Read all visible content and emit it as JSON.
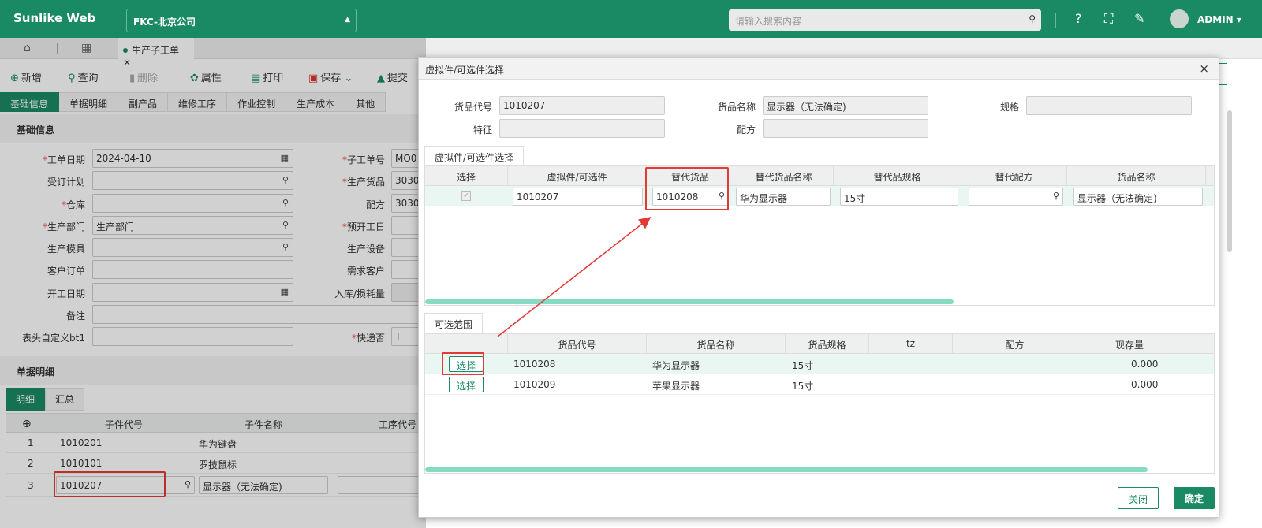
{
  "app": {
    "brand": "Sunlike Web",
    "company": "FKC-北京公司",
    "search_placeholder": "请输入搜索内容",
    "user": "ADMIN"
  },
  "tabs": {
    "doc_tab": "生产子工单"
  },
  "toolbar": {
    "new": "新增",
    "query": "查询",
    "delete": "删除",
    "props": "属性",
    "print": "打印",
    "save": "保存",
    "submit": "提交"
  },
  "form_tabs": [
    "基础信息",
    "单据明细",
    "副产品",
    "维修工序",
    "作业控制",
    "生产成本",
    "其他"
  ],
  "sections": {
    "basic": "基础信息",
    "detail": "单据明细"
  },
  "form": {
    "left": [
      {
        "label": "工单日期",
        "req": true,
        "value": "2024-04-10",
        "icon": "calendar"
      },
      {
        "label": "受订计划",
        "req": false,
        "value": "",
        "icon": "search"
      },
      {
        "label": "仓库",
        "req": true,
        "value": "",
        "icon": "search"
      },
      {
        "label": "生产部门",
        "req": true,
        "value": "生产部门",
        "icon": "search"
      },
      {
        "label": "生产模具",
        "req": false,
        "value": "",
        "icon": "search"
      },
      {
        "label": "客户订单",
        "req": false,
        "value": "",
        "icon": ""
      },
      {
        "label": "开工日期",
        "req": false,
        "value": "",
        "icon": "calendar"
      },
      {
        "label": "备注",
        "req": false,
        "value": "",
        "icon": ""
      },
      {
        "label": "表头自定义bt1",
        "req": false,
        "value": "",
        "icon": ""
      }
    ],
    "right": [
      {
        "label": "子工单号",
        "req": true,
        "value": "MO0"
      },
      {
        "label": "生产货品",
        "req": true,
        "value": "3030"
      },
      {
        "label": "配方",
        "req": false,
        "value": "3030"
      },
      {
        "label": "预开工日",
        "req": true,
        "value": ""
      },
      {
        "label": "生产设备",
        "req": false,
        "value": ""
      },
      {
        "label": "需求客户",
        "req": false,
        "value": ""
      },
      {
        "label": "入库/损耗量",
        "req": false,
        "value": ""
      },
      {
        "label": "",
        "req": false,
        "value": ""
      },
      {
        "label": "快递否",
        "req": true,
        "value": "T"
      }
    ]
  },
  "subtabs": [
    "明细",
    "汇总"
  ],
  "detail_grid": {
    "headers": [
      "子件代号",
      "子件名称",
      "工序代号"
    ],
    "rows": [
      {
        "no": "1",
        "code": "1010201",
        "name": "华为键盘"
      },
      {
        "no": "2",
        "code": "1010101",
        "name": "罗技鼠标"
      },
      {
        "no": "3",
        "code": "1010207",
        "name": "显示器（无法确定)"
      }
    ]
  },
  "dialog": {
    "title": "虚拟件/可选件选择",
    "fields": {
      "code_label": "货品代号",
      "code": "1010207",
      "name_label": "货品名称",
      "name": "显示器（无法确定)",
      "spec_label": "规格",
      "spec": "",
      "feature_label": "特征",
      "feature": "",
      "formula_label": "配方",
      "formula": ""
    },
    "tab1": "虚拟件/可选件选择",
    "grid1": {
      "headers": [
        "选择",
        "虚拟件/可选件",
        "替代货品",
        "替代货品名称",
        "替代品规格",
        "替代配方",
        "货品名称"
      ],
      "row": {
        "virtual": "1010207",
        "sub": "1010208",
        "sub_name": "华为显示器",
        "spec": "15寸",
        "formula": "",
        "name": "显示器（无法确定)"
      }
    },
    "tab2": "可选范围",
    "grid2": {
      "headers": [
        "货品代号",
        "货品名称",
        "货品规格",
        "tz",
        "配方",
        "现存量"
      ],
      "pick": "选择",
      "rows": [
        {
          "code": "1010208",
          "name": "华为显示器",
          "spec": "15寸",
          "tz": "",
          "formula": "",
          "qty": "0.000"
        },
        {
          "code": "1010209",
          "name": "苹果显示器",
          "spec": "15寸",
          "tz": "",
          "formula": "",
          "qty": "0.000"
        }
      ]
    },
    "close": "关闭",
    "ok": "确定"
  }
}
